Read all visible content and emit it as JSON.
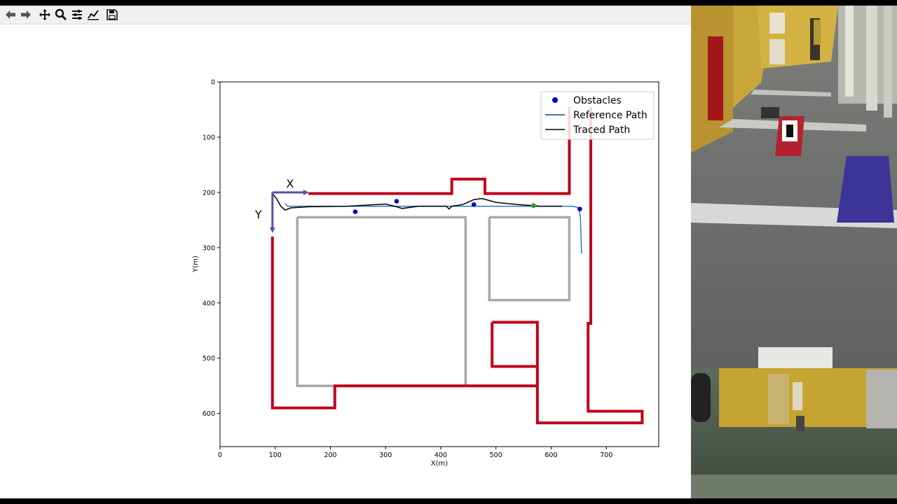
{
  "toolbar": {
    "items": [
      {
        "name": "back-button",
        "icon": "back-arrow-icon"
      },
      {
        "name": "forward-button",
        "icon": "forward-arrow-icon"
      },
      {
        "name": "pan-button",
        "icon": "move-icon"
      },
      {
        "name": "zoom-button",
        "icon": "magnifier-icon"
      },
      {
        "name": "subplots-button",
        "icon": "sliders-icon"
      },
      {
        "name": "customize-button",
        "icon": "line-chart-icon"
      },
      {
        "name": "save-button",
        "icon": "floppy-disk-icon"
      }
    ]
  },
  "chart_data": {
    "type": "line",
    "xlabel": "X(m)",
    "ylabel": "Y(m)",
    "xlim": [
      0,
      795
    ],
    "ylim": [
      660,
      0
    ],
    "y_inverted": true,
    "grid": false,
    "xticks": [
      0,
      100,
      200,
      300,
      400,
      500,
      600,
      700
    ],
    "yticks": [
      0,
      100,
      200,
      300,
      400,
      500,
      600
    ],
    "legend": {
      "placement": "top-right",
      "entries": [
        {
          "label": "Obstacles",
          "marker": "dot",
          "color": "#0000cc"
        },
        {
          "label": "Reference Path",
          "marker": "line",
          "color": "#1f3f8f"
        },
        {
          "label": "Traced Path",
          "marker": "line",
          "color": "#000000"
        }
      ]
    },
    "axes_annotation": {
      "x_label": "X",
      "y_label": "Y",
      "origin": [
        95,
        200
      ],
      "color": "#5b4fa8"
    },
    "obstacles": [
      [
        245,
        235
      ],
      [
        320,
        216
      ],
      [
        460,
        222
      ],
      [
        652,
        230
      ]
    ],
    "goal_point": [
      568,
      224
    ],
    "walls_color": "#c0001a",
    "walls": [
      [
        [
          160,
          202
        ],
        [
          420,
          202
        ],
        [
          420,
          176
        ],
        [
          480,
          176
        ],
        [
          480,
          202
        ],
        [
          633,
          202
        ],
        [
          633,
          45
        ]
      ],
      [
        [
          95,
          280
        ],
        [
          95,
          590
        ],
        [
          208,
          590
        ],
        [
          208,
          550
        ],
        [
          575,
          550
        ]
      ],
      [
        [
          493,
          435
        ],
        [
          575,
          435
        ],
        [
          575,
          617
        ],
        [
          765,
          617
        ],
        [
          765,
          610
        ],
        [
          765,
          596
        ],
        [
          667,
          596
        ],
        [
          667,
          437
        ],
        [
          672,
          437
        ],
        [
          672,
          45
        ]
      ],
      [
        [
          493,
          435
        ],
        [
          493,
          515
        ],
        [
          575,
          515
        ]
      ]
    ],
    "blocks_color": "#a8a8a8",
    "blocks": [
      [
        [
          140,
          245
        ],
        [
          445,
          245
        ],
        [
          445,
          550
        ],
        [
          140,
          550
        ],
        [
          140,
          245
        ]
      ],
      [
        [
          488,
          245
        ],
        [
          633,
          245
        ],
        [
          633,
          395
        ],
        [
          488,
          395
        ],
        [
          488,
          245
        ]
      ]
    ],
    "reference_path_color": "#2a7ab8",
    "reference_path": [
      [
        118,
        220
      ],
      [
        122,
        225
      ],
      [
        640,
        225
      ],
      [
        650,
        228
      ],
      [
        653,
        245
      ],
      [
        655,
        310
      ]
    ],
    "traced_path_color": "#000000",
    "traced_path": [
      [
        95,
        202
      ],
      [
        103,
        212
      ],
      [
        110,
        225
      ],
      [
        118,
        232
      ],
      [
        128,
        228
      ],
      [
        160,
        226
      ],
      [
        230,
        225
      ],
      [
        300,
        221
      ],
      [
        320,
        226
      ],
      [
        330,
        229
      ],
      [
        360,
        225
      ],
      [
        410,
        225
      ],
      [
        415,
        230
      ],
      [
        420,
        225
      ],
      [
        440,
        222
      ],
      [
        460,
        213
      ],
      [
        475,
        211
      ],
      [
        500,
        218
      ],
      [
        540,
        222
      ],
      [
        580,
        225
      ],
      [
        620,
        225
      ]
    ]
  }
}
